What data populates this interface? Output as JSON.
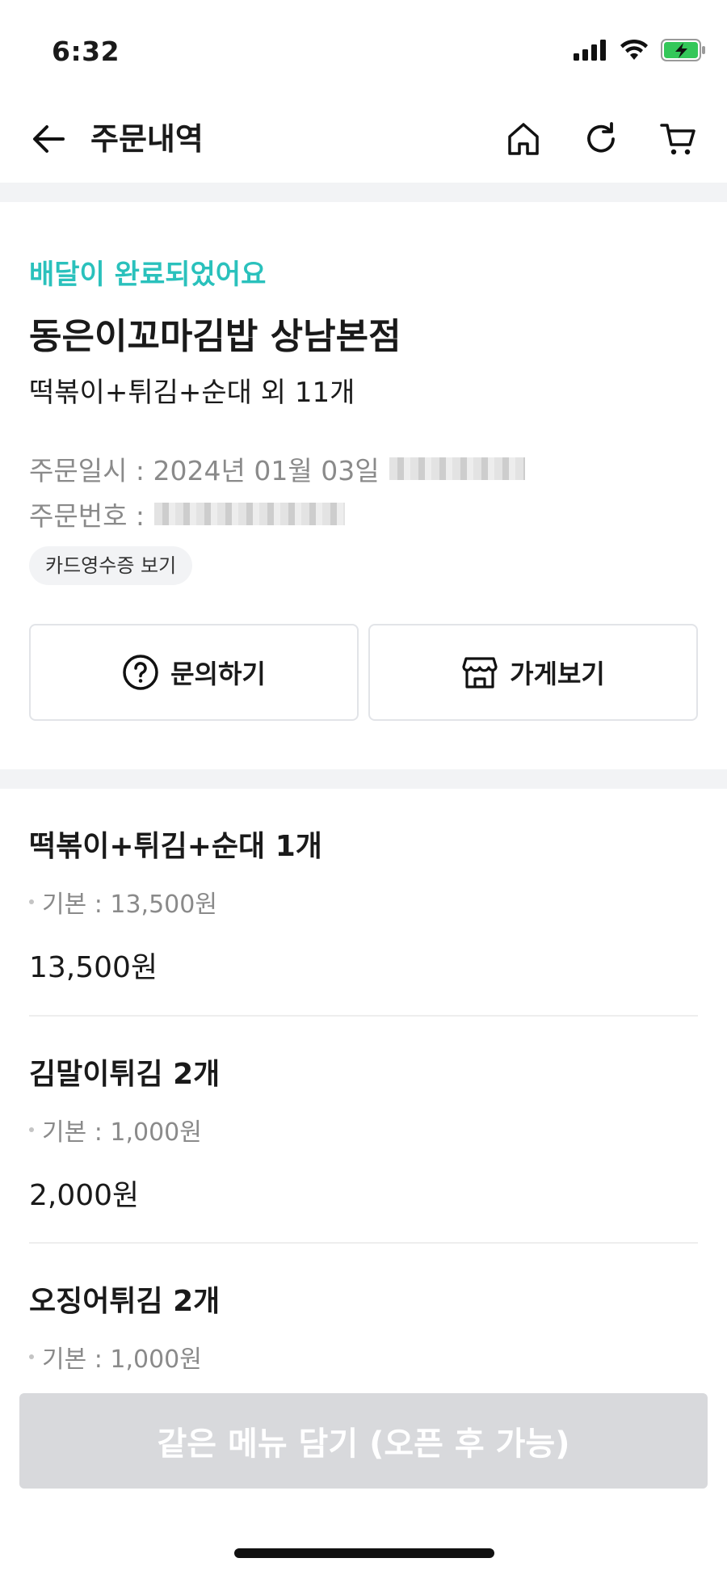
{
  "status_bar": {
    "time": "6:32"
  },
  "header": {
    "title": "주문내역"
  },
  "order": {
    "status": "배달이 완료되었어요",
    "store": "동은이꼬마김밥 상남본점",
    "summary": "떡볶이+튀김+순대 외 11개",
    "date_label": "주문일시 : 2024년 01월 03일",
    "number_label": "주문번호 :",
    "receipt_chip": "카드영수증 보기",
    "inquiry_label": "문의하기",
    "store_view_label": "가게보기"
  },
  "items": [
    {
      "name": "떡볶이+튀김+순대 1개",
      "option": "기본 : 13,500원",
      "price": "13,500원"
    },
    {
      "name": "김말이튀김 2개",
      "option": "기본 : 1,000원",
      "price": "2,000원"
    },
    {
      "name": "오징어튀김 2개",
      "option": "기본 : 1,000원"
    }
  ],
  "cta": {
    "label": "같은 메뉴 담기 (오픈 후 가능)"
  },
  "colors": {
    "accent": "#2ac1bc",
    "band": "#f2f3f5",
    "cta_disabled": "#d8d9dc"
  }
}
